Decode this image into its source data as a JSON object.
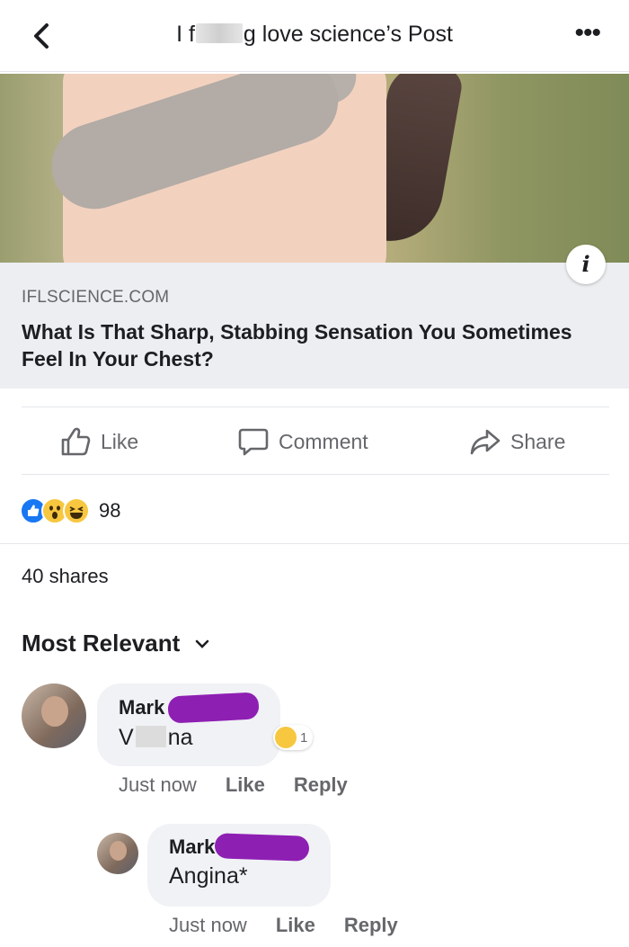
{
  "header": {
    "title_start": "I f",
    "title_end": "g love science’s Post",
    "more_label": "•••"
  },
  "link_preview": {
    "domain": "IFLSCIENCE.COM",
    "headline": "What Is That Sharp, Stabbing Sensation You Sometimes Feel In Your Chest?",
    "info_label": "i"
  },
  "actions": {
    "like": "Like",
    "comment": "Comment",
    "share": "Share"
  },
  "reactions": {
    "types": [
      "like-icon",
      "wow-icon",
      "haha-icon"
    ],
    "count": "98"
  },
  "shares": "40 shares",
  "sort": {
    "label": "Most Relevant"
  },
  "comments": [
    {
      "author": "Mark",
      "text_start": "V",
      "text_end": "na",
      "reaction_count": "1",
      "time": "Just now",
      "like": "Like",
      "reply": "Reply"
    },
    {
      "author": "Mark",
      "text": "Angina*",
      "time": "Just now",
      "like": "Like",
      "reply": "Reply"
    }
  ],
  "colors": {
    "accent": "#1877f2",
    "redaction": "#8e1fb3",
    "secondary_text": "#65676b",
    "bubble": "#f0f2f5"
  }
}
